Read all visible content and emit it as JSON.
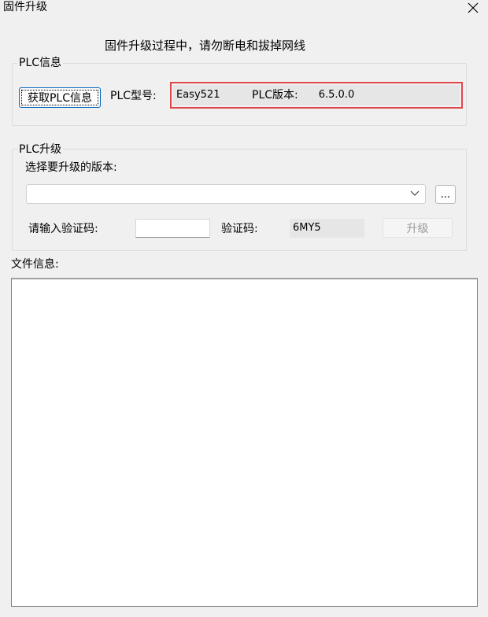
{
  "window": {
    "title": "固件升级",
    "close_glyph": "✕"
  },
  "warning_text": "固件升级过程中，请勿断电和拔掉网线",
  "plc_info": {
    "group_label": "PLC信息",
    "get_button_label": "获取PLC信息",
    "model_label": "PLC型号:",
    "model_value": "Easy521",
    "version_label": "PLC版本:",
    "version_value": "6.5.0.0"
  },
  "plc_upgrade": {
    "group_label": "PLC升级",
    "select_version_label": "选择要升级的版本:",
    "version_combo_value": "",
    "browse_button_label": "...",
    "verify_input_label": "请输入验证码:",
    "verify_input_value": "",
    "verify_code_label": "验证码:",
    "verify_code_value": "6MY5",
    "upgrade_button_label": "升级"
  },
  "file_info": {
    "label": "文件信息:",
    "content": ""
  },
  "colors": {
    "window_bg": "#f0f0f0",
    "highlight_border": "#e0474c",
    "focus_border": "#0067c0"
  },
  "icons": {
    "close": "close-icon",
    "dropdown": "chevron-down-icon"
  }
}
